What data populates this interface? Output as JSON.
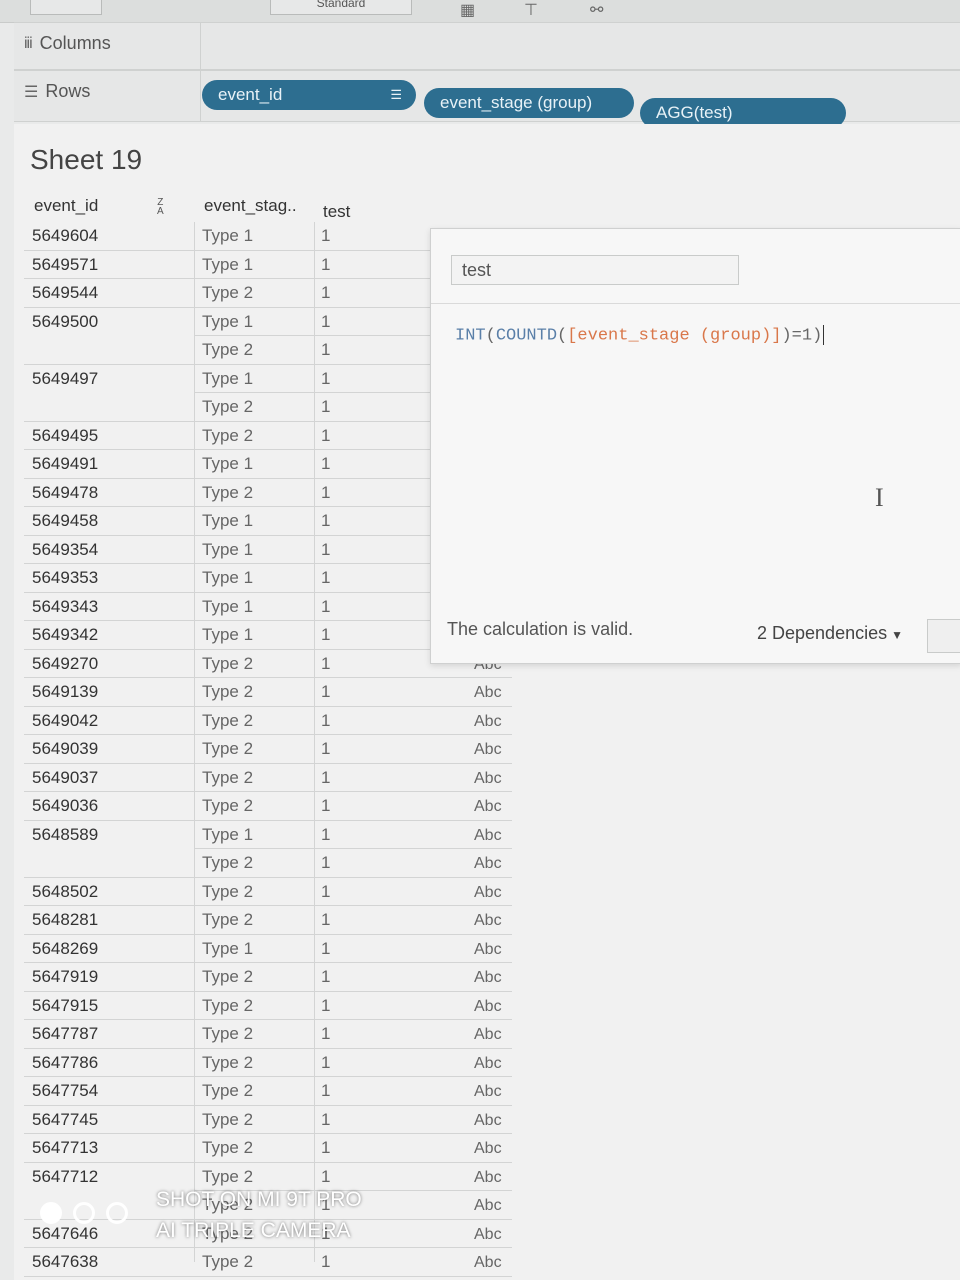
{
  "toolbar": {
    "mark_type": "Standard"
  },
  "shelves": {
    "columns": {
      "label": "Columns"
    },
    "rows": {
      "label": "Rows",
      "pills": [
        "event_id",
        "event_stage (group)",
        "AGG(test)"
      ]
    }
  },
  "sheet": {
    "title": "Sheet 19",
    "headers": {
      "event_id": "event_id",
      "stage": "event_stag..",
      "test": "test"
    },
    "rows": [
      {
        "id": "5649604",
        "stage": "Type 1",
        "val": "1",
        "abc": ""
      },
      {
        "id": "5649571",
        "stage": "Type 1",
        "val": "1",
        "abc": ""
      },
      {
        "id": "5649544",
        "stage": "Type 2",
        "val": "1",
        "abc": ""
      },
      {
        "id": "5649500",
        "stage": "Type 1",
        "val": "1",
        "abc": ""
      },
      {
        "id": "",
        "stage": "Type 2",
        "val": "1",
        "abc": ""
      },
      {
        "id": "5649497",
        "stage": "Type 1",
        "val": "1",
        "abc": ""
      },
      {
        "id": "",
        "stage": "Type 2",
        "val": "1",
        "abc": ""
      },
      {
        "id": "5649495",
        "stage": "Type 2",
        "val": "1",
        "abc": ""
      },
      {
        "id": "5649491",
        "stage": "Type 1",
        "val": "1",
        "abc": ""
      },
      {
        "id": "5649478",
        "stage": "Type 2",
        "val": "1",
        "abc": ""
      },
      {
        "id": "5649458",
        "stage": "Type 1",
        "val": "1",
        "abc": ""
      },
      {
        "id": "5649354",
        "stage": "Type 1",
        "val": "1",
        "abc": ""
      },
      {
        "id": "5649353",
        "stage": "Type 1",
        "val": "1",
        "abc": ""
      },
      {
        "id": "5649343",
        "stage": "Type 1",
        "val": "1",
        "abc": ""
      },
      {
        "id": "5649342",
        "stage": "Type 1",
        "val": "1",
        "abc": ""
      },
      {
        "id": "5649270",
        "stage": "Type 2",
        "val": "1",
        "abc": "Abc"
      },
      {
        "id": "5649139",
        "stage": "Type 2",
        "val": "1",
        "abc": "Abc"
      },
      {
        "id": "5649042",
        "stage": "Type 2",
        "val": "1",
        "abc": "Abc"
      },
      {
        "id": "5649039",
        "stage": "Type 2",
        "val": "1",
        "abc": "Abc"
      },
      {
        "id": "5649037",
        "stage": "Type 2",
        "val": "1",
        "abc": "Abc"
      },
      {
        "id": "5649036",
        "stage": "Type 2",
        "val": "1",
        "abc": "Abc"
      },
      {
        "id": "5648589",
        "stage": "Type 1",
        "val": "1",
        "abc": "Abc"
      },
      {
        "id": "",
        "stage": "Type 2",
        "val": "1",
        "abc": "Abc"
      },
      {
        "id": "5648502",
        "stage": "Type 2",
        "val": "1",
        "abc": "Abc"
      },
      {
        "id": "5648281",
        "stage": "Type 2",
        "val": "1",
        "abc": "Abc"
      },
      {
        "id": "5648269",
        "stage": "Type 1",
        "val": "1",
        "abc": "Abc"
      },
      {
        "id": "5647919",
        "stage": "Type 2",
        "val": "1",
        "abc": "Abc"
      },
      {
        "id": "5647915",
        "stage": "Type 2",
        "val": "1",
        "abc": "Abc"
      },
      {
        "id": "5647787",
        "stage": "Type 2",
        "val": "1",
        "abc": "Abc"
      },
      {
        "id": "5647786",
        "stage": "Type 2",
        "val": "1",
        "abc": "Abc"
      },
      {
        "id": "5647754",
        "stage": "Type 2",
        "val": "1",
        "abc": "Abc"
      },
      {
        "id": "5647745",
        "stage": "Type 2",
        "val": "1",
        "abc": "Abc"
      },
      {
        "id": "5647713",
        "stage": "Type 2",
        "val": "1",
        "abc": "Abc"
      },
      {
        "id": "5647712",
        "stage": "Type 2",
        "val": "1",
        "abc": "Abc"
      },
      {
        "id": "",
        "stage": "Type 2",
        "val": "1",
        "abc": "Abc"
      },
      {
        "id": "5647646",
        "stage": "Type 2",
        "val": "1",
        "abc": "Abc"
      },
      {
        "id": "5647638",
        "stage": "Type 2",
        "val": "1",
        "abc": "Abc"
      }
    ]
  },
  "calc_editor": {
    "name": "test",
    "formula": {
      "p1": "INT",
      "p2": "(",
      "p3": "COUNTD",
      "p4": "(",
      "p5": "[event_stage (group)]",
      "p6": ")=1)"
    },
    "status": "The calculation is valid.",
    "dependencies": "2 Dependencies"
  },
  "watermark": {
    "line1": "SHOT ON MI 9T PRO",
    "line2": "AI TRIPLE CAMERA"
  }
}
